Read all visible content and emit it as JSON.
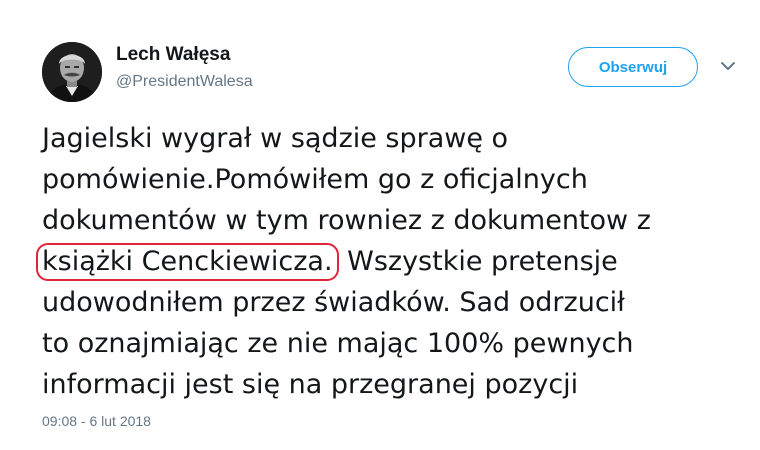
{
  "author": {
    "name": "Lech Wałęsa",
    "handle": "@PresidentWalesa"
  },
  "follow_button": {
    "label": "Obserwuj"
  },
  "tweet": {
    "lines": [
      "Jagielski wygrał w sądzie sprawę  o",
      "pomówienie.Pomówiłem go z oficjalnych",
      "dokumentów  w tym rowniez z dokumentow z",
      "Wszystkie pretensje",
      "udowodniłem przez świadków. Sad odrzucił",
      "to oznajmiając ze nie mając 100% pewnych",
      "informacji jest się na przegranej pozycji"
    ],
    "highlighted_text": "książki Cenckiewicza.",
    "highlight_color": "#e0243a",
    "timestamp": "09:08 - 6 lut 2018"
  },
  "icons": {
    "menu": "chevron-down-icon"
  },
  "colors": {
    "accent": "#1da1f2",
    "secondary_text": "#657786",
    "primary_text": "#14171a"
  }
}
